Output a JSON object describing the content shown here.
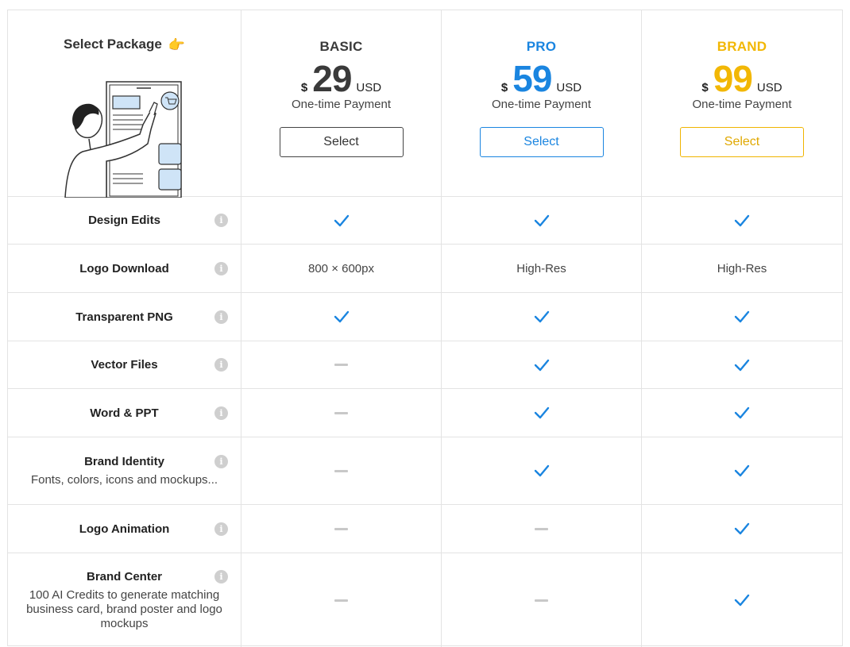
{
  "header": {
    "select_title": "Select Package",
    "hand_icon": "👉"
  },
  "plans": [
    {
      "name": "BASIC",
      "currency": "$",
      "amount": "29",
      "unit": "USD",
      "payment": "One-time Payment",
      "button": "Select",
      "color": "#3a3a3a"
    },
    {
      "name": "PRO",
      "currency": "$",
      "amount": "59",
      "unit": "USD",
      "payment": "One-time Payment",
      "button": "Select",
      "color": "#1a85e0"
    },
    {
      "name": "BRAND",
      "currency": "$",
      "amount": "99",
      "unit": "USD",
      "payment": "One-time Payment",
      "button": "Select",
      "color": "#f2b705"
    }
  ],
  "features": [
    {
      "name": "Design Edits",
      "desc": "",
      "values": [
        "check",
        "check",
        "check"
      ]
    },
    {
      "name": "Logo Download",
      "desc": "",
      "values": [
        "800 × 600px",
        "High-Res",
        "High-Res"
      ]
    },
    {
      "name": "Transparent PNG",
      "desc": "",
      "values": [
        "check",
        "check",
        "check"
      ]
    },
    {
      "name": "Vector Files",
      "desc": "",
      "values": [
        "dash",
        "check",
        "check"
      ]
    },
    {
      "name": "Word & PPT",
      "desc": "",
      "values": [
        "dash",
        "check",
        "check"
      ]
    },
    {
      "name": "Brand Identity",
      "desc": "Fonts, colors, icons and mockups...",
      "values": [
        "dash",
        "check",
        "check"
      ]
    },
    {
      "name": "Logo Animation",
      "desc": "",
      "values": [
        "dash",
        "dash",
        "check"
      ]
    },
    {
      "name": "Brand Center",
      "desc": "100 AI Credits to generate matching business card, brand poster and logo mockups",
      "values": [
        "dash",
        "dash",
        "check"
      ]
    }
  ],
  "icons": {
    "info": "info-icon",
    "check": "check-icon",
    "dash": "dash-icon"
  },
  "colors": {
    "check": "#1a85e0",
    "dash": "#c8c8c8",
    "border": "#e3e3e3"
  }
}
